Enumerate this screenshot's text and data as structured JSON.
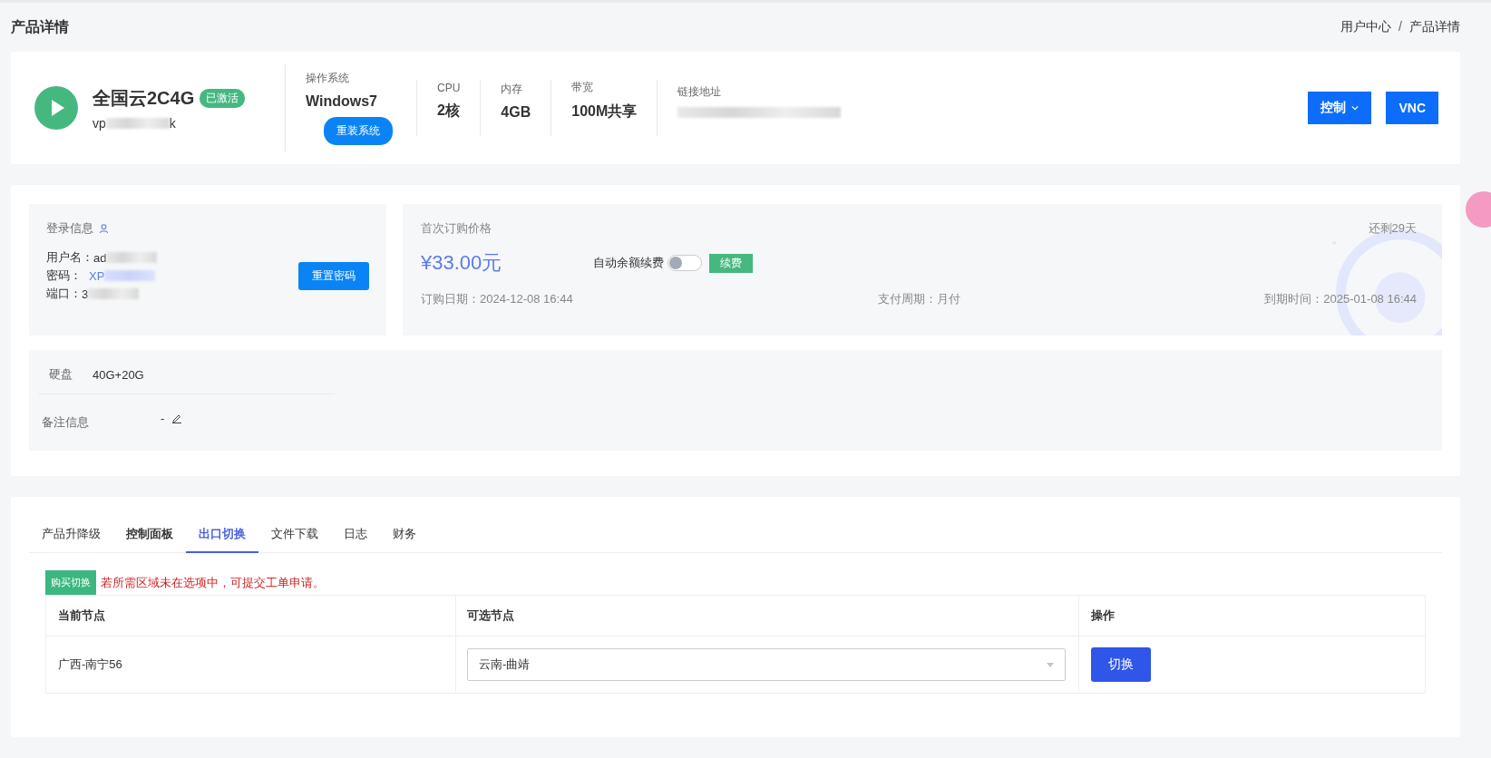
{
  "page": {
    "title": "产品详情",
    "breadcrumb": [
      "用户中心",
      "产品详情"
    ],
    "separator": "/"
  },
  "product": {
    "name": "全国云2C4G",
    "status": "已激活",
    "id": "vp",
    "id_end": "k",
    "os": {
      "label": "操作系统",
      "value": "Windows7",
      "button": "重装系统"
    },
    "specs": [
      {
        "label": "CPU",
        "value": "2核"
      },
      {
        "label": "内存",
        "value": "4GB"
      },
      {
        "label": "带宽",
        "value": "100M共享"
      }
    ],
    "link": {
      "label": "链接地址"
    },
    "buttons": [
      {
        "label": "控制",
        "dropdown": true
      },
      {
        "label": "VNC",
        "dropdown": false
      }
    ]
  },
  "login": {
    "title": "登录信息",
    "rows": [
      {
        "label": "用户名：",
        "value": "ad",
        "kind": "plain"
      },
      {
        "label": "密码：",
        "value": "XP",
        "kind": "link"
      },
      {
        "label": "端口：",
        "value": "3",
        "kind": "plain"
      }
    ],
    "button": "重置密码"
  },
  "price": {
    "title": "首次订购价格",
    "remaining": "还剩29天",
    "amount": "¥33.00元",
    "auto_renew": {
      "label": "自动余额续费",
      "on": false
    },
    "renew_button": "续费",
    "order_date": "订购日期：2024-12-08 16:44",
    "cycle": "支付周期：月付",
    "expire": "到期时间：2025-01-08 16:44"
  },
  "details": [
    {
      "label": "硬盘",
      "value": "40G+20G",
      "editable": false
    },
    {
      "label": "备注信息",
      "value": "-",
      "editable": true
    }
  ],
  "tabs": [
    {
      "label": "产品升降级",
      "selected": false,
      "bold": false
    },
    {
      "label": "控制面板",
      "selected": false,
      "bold": true
    },
    {
      "label": "出口切换",
      "selected": true,
      "bold": true
    },
    {
      "label": "文件下载",
      "selected": false,
      "bold": false
    },
    {
      "label": "日志",
      "selected": false,
      "bold": false
    },
    {
      "label": "财务",
      "selected": false,
      "bold": false
    }
  ],
  "notice": {
    "tag": "购买切换",
    "text": "若所需区域未在选项中，可提交工单申请。"
  },
  "table": {
    "columns": [
      "当前节点",
      "可选节点",
      "操作"
    ],
    "rows": [
      {
        "current": "广西-南宁56",
        "option": "云南-曲靖",
        "action": "切换"
      }
    ]
  }
}
